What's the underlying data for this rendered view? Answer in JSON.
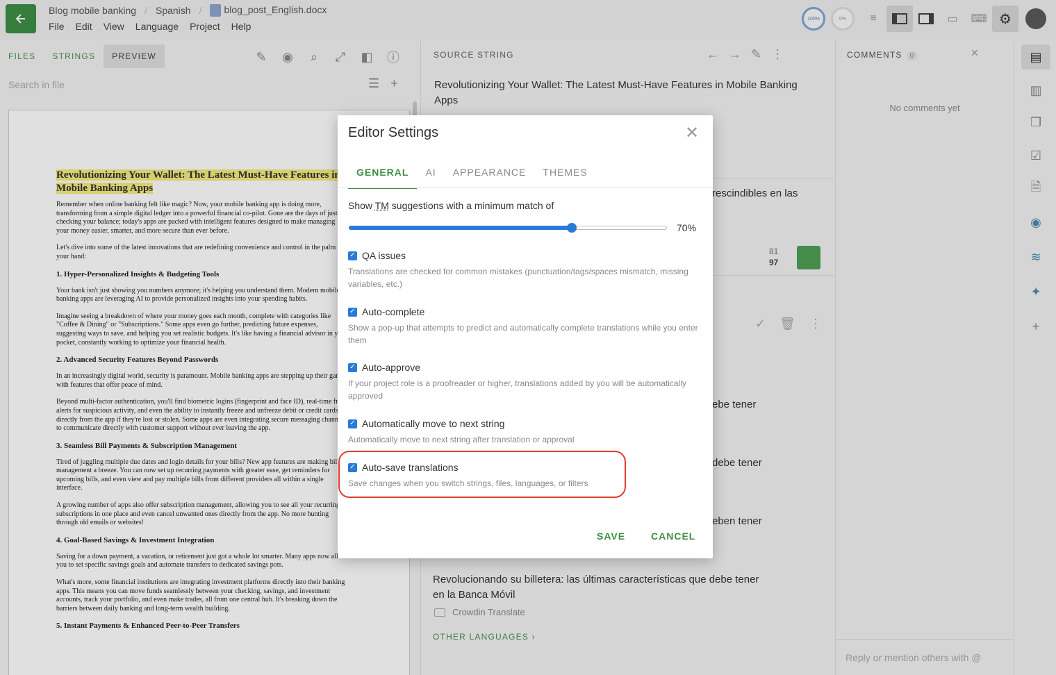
{
  "topbar": {
    "breadcrumb": [
      "Blog mobile banking",
      "Spanish",
      "blog_post_English.docx"
    ],
    "menu": [
      "File",
      "Edit",
      "View",
      "Language",
      "Project",
      "Help"
    ],
    "progress_translated": "100%",
    "progress_approved": "0%"
  },
  "left": {
    "tabs": [
      "FILES",
      "STRINGS",
      "PREVIEW"
    ],
    "active_tab": "PREVIEW",
    "search_placeholder": "Search in file",
    "doc": {
      "title": "Revolutionizing Your Wallet: The Latest Must-Have Features in Mobile Banking Apps",
      "paragraphs": [
        "Remember when online banking felt like magic? Now, your mobile banking app is doing more, transforming from a simple digital ledger into a powerful financial co-pilot. Gone are the days of just checking your balance; today's apps are packed with intelligent features designed to make managing your money easier, smarter, and more secure than ever before.",
        "Let's dive into some of the latest innovations that are redefining convenience and control in the palm of your hand:"
      ],
      "sections": [
        {
          "heading": "1. Hyper-Personalized Insights & Budgeting Tools",
          "paras": [
            "Your bank isn't just showing you numbers anymore; it's helping you understand them. Modern mobile banking apps are leveraging AI to provide personalized insights into your spending habits.",
            "Imagine seeing a breakdown of where your money goes each month, complete with categories like \"Coffee & Dining\" or \"Subscriptions.\" Some apps even go further, predicting future expenses, suggesting ways to save, and helping you set realistic budgets. It's like having a financial advisor in your pocket, constantly working to optimize your financial health."
          ]
        },
        {
          "heading": "2. Advanced Security Features Beyond Passwords",
          "paras": [
            "In an increasingly digital world, security is paramount. Mobile banking apps are stepping up their game with features that offer peace of mind.",
            "Beyond multi-factor authentication, you'll find biometric logins (fingerprint and face ID), real-time fraud alerts for suspicious activity, and even the ability to instantly freeze and unfreeze debit or credit cards directly from the app if they're lost or stolen. Some apps are even integrating secure messaging channels to communicate directly with customer support without ever leaving the app."
          ]
        },
        {
          "heading": "3. Seamless Bill Payments & Subscription Management",
          "paras": [
            "Tired of juggling multiple due dates and login details for your bills? New app features are making bill management a breeze. You can now set up recurring payments with greater ease, get reminders for upcoming bills, and even view and pay multiple bills from different providers all within a single interface.",
            "A growing number of apps also offer subscription management, allowing you to see all your recurring subscriptions in one place and even cancel unwanted ones directly from the app. No more hunting through old emails or websites!"
          ]
        },
        {
          "heading": "4. Goal-Based Savings & Investment Integration",
          "paras": [
            "Saving for a down payment, a vacation, or retirement just got a whole lot smarter. Many apps now allow you to set specific savings goals and automate transfers to dedicated savings pots.",
            "What's more, some financial institutions are integrating investment platforms directly into their banking apps. This means you can move funds seamlessly between your checking, savings, and investment accounts, track your portfolio, and even make trades, all from one central hub. It's breaking down the barriers between daily banking and long-term wealth building."
          ]
        },
        {
          "heading": "5. Instant Payments & Enhanced Peer-to-Peer Transfers",
          "paras": []
        }
      ]
    }
  },
  "middle": {
    "header": "SOURCE STRING",
    "source_text": "Revolutionizing Your Wallet: The Latest Must-Have Features in Mobile Banking Apps",
    "fragment1": "rescindibles en las",
    "score_top": "81",
    "score_bottom": "97",
    "fragment2": "ebe tener",
    "fragment3": "debe tener",
    "fragment4": "eben tener",
    "translation": "Revolucionando su billetera: las últimas características que debe tener en la Banca Móvil",
    "engine": "Crowdin Translate",
    "other_languages": "OTHER LANGUAGES"
  },
  "comments": {
    "header": "COMMENTS",
    "count": "0",
    "empty": "No comments yet",
    "reply_placeholder": "Reply or mention others with @"
  },
  "modal": {
    "title": "Editor Settings",
    "tabs": [
      "GENERAL",
      "AI",
      "APPEARANCE",
      "THEMES"
    ],
    "active_tab": "GENERAL",
    "tm_prefix": "Show ",
    "tm_abbr": "TM",
    "tm_suffix": " suggestions with a minimum match of",
    "tm_value": 70,
    "tm_value_label": "70%",
    "options": [
      {
        "label": "QA issues",
        "desc": "Translations are checked for common mistakes (punctuation/tags/spaces mismatch, missing variables, etc.)",
        "checked": true
      },
      {
        "label": "Auto-complete",
        "desc": "Show a pop-up that attempts to predict and automatically complete translations while you enter them",
        "checked": true
      },
      {
        "label": "Auto-approve",
        "desc": "If your project role is a proofreader or higher, translations added by you will be automatically approved",
        "checked": true
      },
      {
        "label": "Automatically move to next string",
        "desc": "Automatically move to next string after translation or approval",
        "checked": true
      },
      {
        "label": "Auto-save translations",
        "desc": "Save changes when you switch strings, files, languages, or filters",
        "checked": true
      }
    ],
    "save": "SAVE",
    "cancel": "CANCEL"
  },
  "colors": {
    "accent_green": "#3e8e46",
    "checkbox_blue": "#2a7bd6",
    "highlight_red": "#e23b2e"
  }
}
